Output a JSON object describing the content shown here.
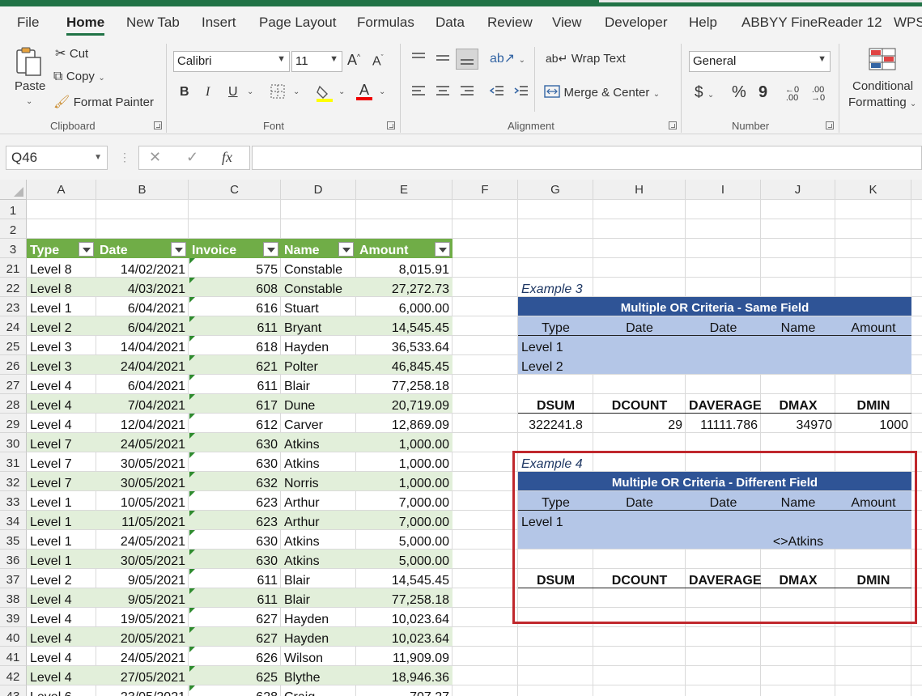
{
  "tabs": [
    "File",
    "Home",
    "New Tab",
    "Insert",
    "Page Layout",
    "Formulas",
    "Data",
    "Review",
    "View",
    "Developer",
    "Help",
    "ABBYY FineReader 12",
    "WPS"
  ],
  "active_tab": "Home",
  "clipboard": {
    "paste": "Paste",
    "cut": "Cut",
    "copy": "Copy",
    "format_painter": "Format Painter",
    "group": "Clipboard"
  },
  "font": {
    "name": "Calibri",
    "size": "11",
    "bold": "B",
    "italic": "I",
    "underline": "U",
    "font_color": "A",
    "group": "Font"
  },
  "alignment": {
    "wrap_text": "Wrap Text",
    "merge_center": "Merge & Center",
    "group": "Alignment"
  },
  "number": {
    "format": "General",
    "currency": "$",
    "percent": "%",
    "comma": "9",
    "group": "Number"
  },
  "styles": {
    "conditional_line1": "Conditional",
    "conditional_line2": "Formatting"
  },
  "formula_bar": {
    "name_box": "Q46",
    "fx": "fx",
    "cancel": "✕",
    "enter": "✓",
    "value": ""
  },
  "columns": [
    "A",
    "B",
    "C",
    "D",
    "E",
    "F",
    "G",
    "H",
    "I",
    "J",
    "K"
  ],
  "row_numbers": [
    "1",
    "2",
    "3",
    "21",
    "22",
    "23",
    "24",
    "25",
    "26",
    "27",
    "28",
    "29",
    "30",
    "31",
    "32",
    "33",
    "34",
    "35",
    "36",
    "37",
    "38",
    "39",
    "40",
    "41",
    "42",
    "43"
  ],
  "table": {
    "headers": [
      "Type",
      "Date",
      "Invoice",
      "Name",
      "Amount"
    ],
    "rows": [
      [
        "Level 8",
        "14/02/2021",
        "575",
        "Constable",
        "8,015.91"
      ],
      [
        "Level 8",
        "4/03/2021",
        "608",
        "Constable",
        "27,272.73"
      ],
      [
        "Level 1",
        "6/04/2021",
        "616",
        "Stuart",
        "6,000.00"
      ],
      [
        "Level 2",
        "6/04/2021",
        "611",
        "Bryant",
        "14,545.45"
      ],
      [
        "Level 3",
        "14/04/2021",
        "618",
        "Hayden",
        "36,533.64"
      ],
      [
        "Level 3",
        "24/04/2021",
        "621",
        "Polter",
        "46,845.45"
      ],
      [
        "Level 4",
        "6/04/2021",
        "611",
        "Blair",
        "77,258.18"
      ],
      [
        "Level 4",
        "7/04/2021",
        "617",
        "Dune",
        "20,719.09"
      ],
      [
        "Level 4",
        "12/04/2021",
        "612",
        "Carver",
        "12,869.09"
      ],
      [
        "Level 7",
        "24/05/2021",
        "630",
        "Atkins",
        "1,000.00"
      ],
      [
        "Level 7",
        "30/05/2021",
        "630",
        "Atkins",
        "1,000.00"
      ],
      [
        "Level 7",
        "30/05/2021",
        "632",
        "Norris",
        "1,000.00"
      ],
      [
        "Level 1",
        "10/05/2021",
        "623",
        "Arthur",
        "7,000.00"
      ],
      [
        "Level 1",
        "11/05/2021",
        "623",
        "Arthur",
        "7,000.00"
      ],
      [
        "Level 1",
        "24/05/2021",
        "630",
        "Atkins",
        "5,000.00"
      ],
      [
        "Level 1",
        "30/05/2021",
        "630",
        "Atkins",
        "5,000.00"
      ],
      [
        "Level 2",
        "9/05/2021",
        "611",
        "Blair",
        "14,545.45"
      ],
      [
        "Level 4",
        "9/05/2021",
        "611",
        "Blair",
        "77,258.18"
      ],
      [
        "Level 4",
        "19/05/2021",
        "627",
        "Hayden",
        "10,023.64"
      ],
      [
        "Level 4",
        "20/05/2021",
        "627",
        "Hayden",
        "10,023.64"
      ],
      [
        "Level 4",
        "24/05/2021",
        "626",
        "Wilson",
        "11,909.09"
      ],
      [
        "Level 4",
        "27/05/2021",
        "625",
        "Blythe",
        "18,946.36"
      ],
      [
        "Level 6",
        "23/05/2021",
        "628",
        "Craig",
        "707.27"
      ]
    ]
  },
  "example3": {
    "label": "Example 3",
    "title": "Multiple OR Criteria - Same Field",
    "headers": [
      "Type",
      "Date",
      "Date",
      "Name",
      "Amount"
    ],
    "criteria": [
      "Level 1",
      "Level 2"
    ],
    "func_headers": [
      "DSUM",
      "DCOUNT",
      "DAVERAGE",
      "DMAX",
      "DMIN"
    ],
    "results": [
      "322241.8",
      "29",
      "11111.786",
      "34970",
      "1000"
    ]
  },
  "example4": {
    "label": "Example 4",
    "title": "Multiple OR Criteria - Different Field",
    "headers": [
      "Type",
      "Date",
      "Date",
      "Name",
      "Amount"
    ],
    "criteria_type": "Level 1",
    "criteria_name": "<>Atkins",
    "func_headers": [
      "DSUM",
      "DCOUNT",
      "DAVERAGE",
      "DMAX",
      "DMIN"
    ]
  },
  "colors": {
    "excel_green": "#217346",
    "table_header": "#70ad47",
    "band": "#e2efda",
    "navy": "#2f5496",
    "light_blue": "#b4c6e7",
    "highlight_red": "#c0282d"
  }
}
